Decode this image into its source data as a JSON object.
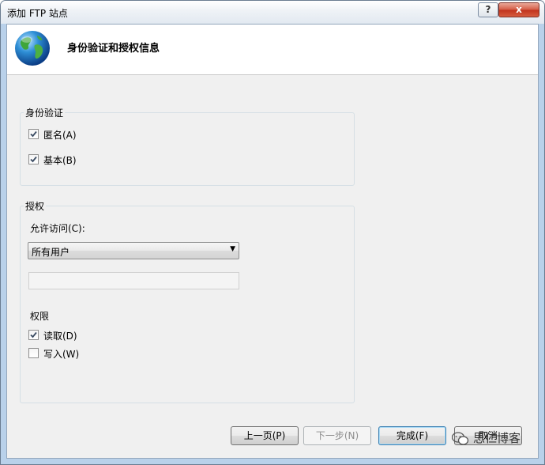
{
  "window": {
    "title": "添加 FTP 站点",
    "help_label": "?",
    "close_label": "x"
  },
  "header": {
    "title": "身份验证和授权信息"
  },
  "authentication": {
    "group_title": "身份验证",
    "anonymous": {
      "label": "匿名(A)",
      "checked": true
    },
    "basic": {
      "label": "基本(B)",
      "checked": true
    }
  },
  "authorization": {
    "group_title": "授权",
    "allow_access_label": "允许访问(C):",
    "allow_access_value": "所有用户",
    "user_input_value": ""
  },
  "permissions": {
    "title": "权限",
    "read": {
      "label": "读取(D)",
      "checked": true
    },
    "write": {
      "label": "写入(W)",
      "checked": false
    }
  },
  "buttons": {
    "prev": "上一页(P)",
    "next": "下一步(N)",
    "finish": "完成(F)",
    "cancel": "取消"
  },
  "watermark": {
    "text": "思仁博客"
  }
}
